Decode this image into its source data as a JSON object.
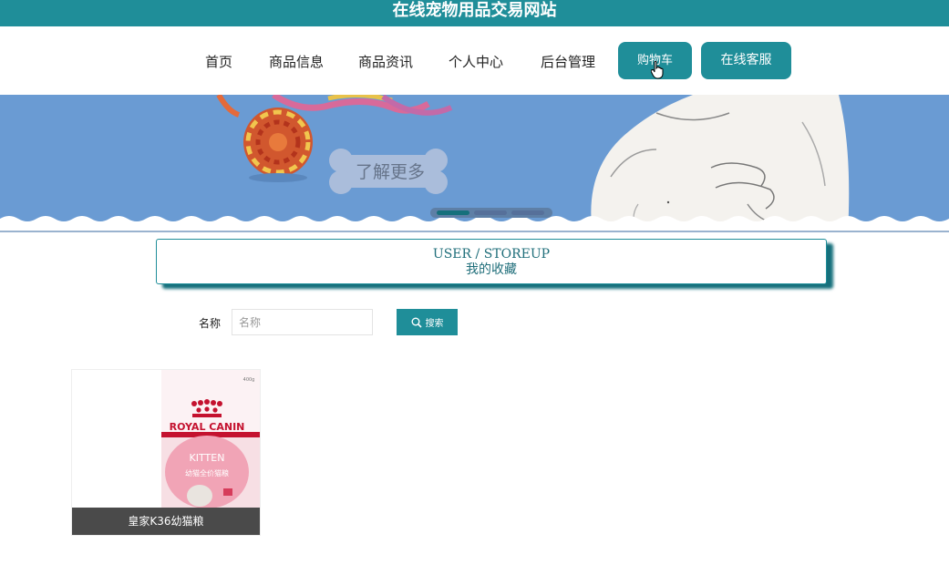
{
  "site": {
    "title": "在线宠物用品交易网站"
  },
  "nav": {
    "items": [
      "首页",
      "商品信息",
      "商品资讯",
      "个人中心",
      "后台管理"
    ],
    "cart_label": "购物车",
    "service_label": "在线客服"
  },
  "banner": {
    "button_label": "了解更多"
  },
  "section": {
    "title_en": "USER / STOREUP",
    "title_cn": "我的收藏"
  },
  "search": {
    "label": "名称",
    "placeholder": "名称",
    "value": "",
    "button_label": "搜索"
  },
  "products": [
    {
      "name": "皇家K36幼猫粮",
      "package": {
        "brand": "ROYAL CANIN",
        "variant": "KITTEN",
        "subtitle": "幼猫全价猫粮",
        "weight": "400g"
      }
    }
  ],
  "colors": {
    "primary": "#1f8e99",
    "banner_bg": "#6a9bd3",
    "card_caption_bg": "#4a4a4a"
  }
}
